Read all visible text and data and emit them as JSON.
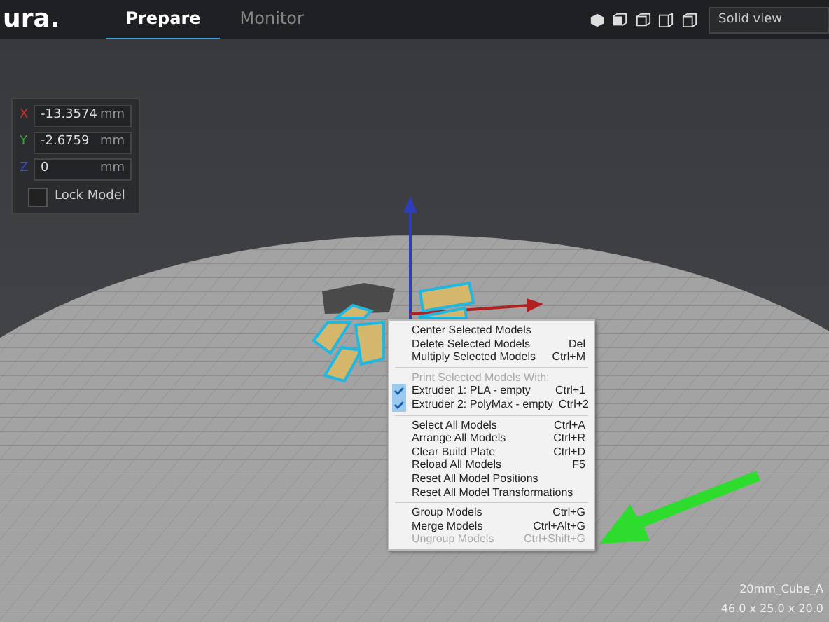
{
  "header": {
    "logo": "ura.",
    "tabs": [
      {
        "label": "Prepare",
        "selected": true
      },
      {
        "label": "Monitor",
        "selected": false
      }
    ],
    "view_mode": "Solid view"
  },
  "position_panel": {
    "fields": [
      {
        "axis": "X",
        "value": "-13.3574",
        "unit": "mm",
        "color": "#d0312d"
      },
      {
        "axis": "Y",
        "value": "-2.6759",
        "unit": "mm",
        "color": "#3aa63a"
      },
      {
        "axis": "Z",
        "value": "0",
        "unit": "mm",
        "color": "#3b4fc4"
      }
    ],
    "lock": {
      "label": "Lock Model",
      "checked": false
    }
  },
  "context_menu": {
    "groups": [
      [
        {
          "kind": "action",
          "label": "Center Selected Models",
          "disabled": false
        },
        {
          "kind": "action",
          "label": "Delete Selected Models",
          "shortcut": "Del",
          "disabled": false
        },
        {
          "kind": "action",
          "label": "Multiply Selected Models",
          "shortcut": "Ctrl+M",
          "disabled": false
        }
      ],
      [
        {
          "kind": "heading",
          "label": "Print Selected Models With:"
        },
        {
          "kind": "toggle",
          "label": "Extruder 1: PLA - empty",
          "shortcut": "Ctrl+1",
          "checked": true
        },
        {
          "kind": "toggle",
          "label": "Extruder 2: PolyMax - empty",
          "shortcut": "Ctrl+2",
          "checked": true
        }
      ],
      [
        {
          "kind": "action",
          "label": "Select All Models",
          "shortcut": "Ctrl+A",
          "disabled": false
        },
        {
          "kind": "action",
          "label": "Arrange All Models",
          "shortcut": "Ctrl+R",
          "disabled": false
        },
        {
          "kind": "action",
          "label": "Clear Build Plate",
          "shortcut": "Ctrl+D",
          "disabled": false
        },
        {
          "kind": "action",
          "label": "Reload All Models",
          "shortcut": "F5",
          "disabled": false
        },
        {
          "kind": "action",
          "label": "Reset All Model Positions",
          "disabled": false
        },
        {
          "kind": "action",
          "label": "Reset All Model Transformations",
          "disabled": false
        }
      ],
      [
        {
          "kind": "action",
          "label": "Group Models",
          "shortcut": "Ctrl+G",
          "disabled": false
        },
        {
          "kind": "action",
          "label": "Merge Models",
          "shortcut": "Ctrl+Alt+G",
          "disabled": false
        },
        {
          "kind": "action",
          "label": "Ungroup Models",
          "shortcut": "Ctrl+Shift+G",
          "disabled": true
        }
      ]
    ]
  },
  "object_info": {
    "name": "20mm_Cube_A",
    "dimensions": "46.0 x 25.0 x 20.0"
  }
}
